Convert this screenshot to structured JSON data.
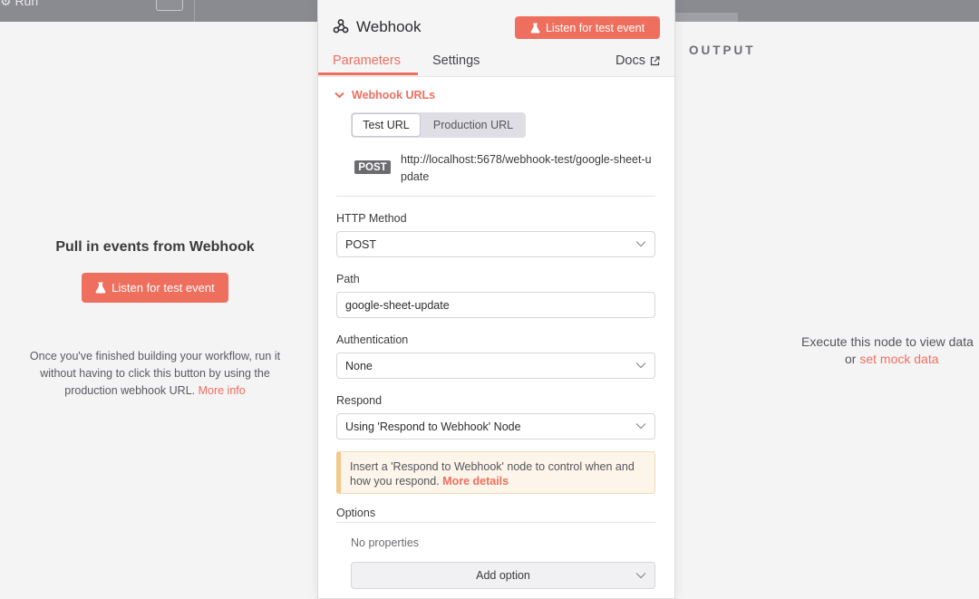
{
  "topbar": {
    "crumb": "⚙ Run"
  },
  "input_panel": {
    "title": "Pull in events from Webhook",
    "listen_button": "Listen for test event",
    "help_text": "Once you've finished building your workflow, run it without having to click this button by using the production webhook URL. ",
    "help_link": "More info"
  },
  "node": {
    "title": "Webhook",
    "listen_button": "Listen for test event",
    "tabs": {
      "parameters": "Parameters",
      "settings": "Settings",
      "docs": "Docs"
    },
    "webhook_urls": {
      "label": "Webhook URLs",
      "test_tab": "Test URL",
      "production_tab": "Production URL",
      "method": "POST",
      "url": "http://localhost:5678/webhook-test/google-sheet-update"
    },
    "http_method": {
      "label": "HTTP Method",
      "value": "POST"
    },
    "path": {
      "label": "Path",
      "value": "google-sheet-update"
    },
    "authentication": {
      "label": "Authentication",
      "value": "None"
    },
    "respond": {
      "label": "Respond",
      "value": "Using 'Respond to Webhook' Node"
    },
    "notice": {
      "text": "Insert a 'Respond to Webhook' node to control when and how you respond. ",
      "link": "More details"
    },
    "options": {
      "label": "Options",
      "empty": "No properties",
      "add_button": "Add option"
    }
  },
  "output_panel": {
    "label": "OUTPUT",
    "message": "Execute this node to view data",
    "message_or": "or ",
    "mock_link": "set mock data"
  },
  "colors": {
    "accent": "#ef6f5e",
    "panel_bg": "#ffffff",
    "canvas_bg": "#f4f4f5"
  }
}
